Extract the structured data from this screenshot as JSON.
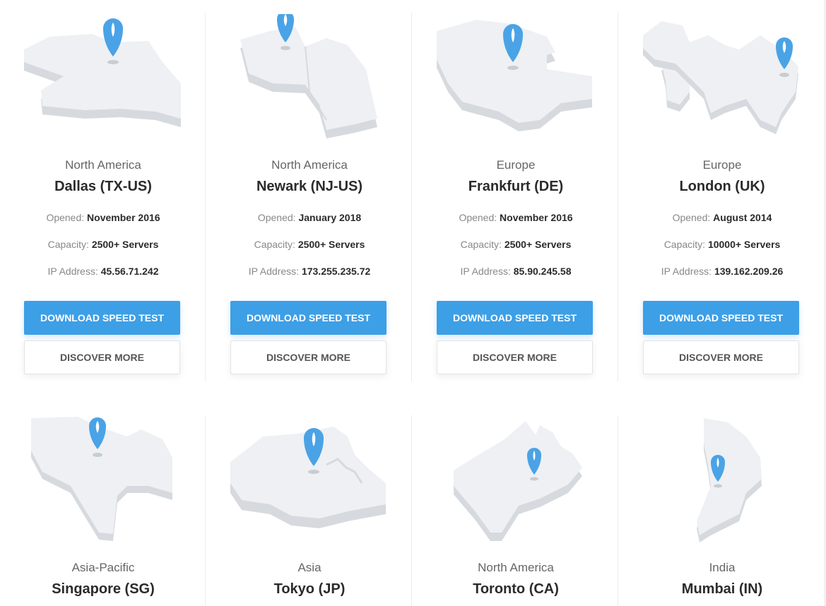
{
  "labels": {
    "opened": "Opened:",
    "capacity": "Capacity:",
    "ip": "IP Address:",
    "download": "DOWNLOAD SPEED TEST",
    "discover": "DISCOVER MORE"
  },
  "colors": {
    "accent": "#3d9fe6",
    "map_top": "#eef0f3",
    "map_side": "#d6dade",
    "pin": "#4aa3e6"
  },
  "locations": [
    {
      "region": "North America",
      "city": "Dallas (TX-US)",
      "opened": "November 2016",
      "capacity": "2500+ Servers",
      "ip": "45.56.71.242"
    },
    {
      "region": "North America",
      "city": "Newark (NJ-US)",
      "opened": "January 2018",
      "capacity": "2500+ Servers",
      "ip": "173.255.235.72"
    },
    {
      "region": "Europe",
      "city": "Frankfurt (DE)",
      "opened": "November 2016",
      "capacity": "2500+ Servers",
      "ip": "85.90.245.58"
    },
    {
      "region": "Europe",
      "city": "London (UK)",
      "opened": "August 2014",
      "capacity": "10000+ Servers",
      "ip": "139.162.209.26"
    },
    {
      "region": "Asia-Pacific",
      "city": "Singapore (SG)"
    },
    {
      "region": "Asia",
      "city": "Tokyo (JP)"
    },
    {
      "region": "North America",
      "city": "Toronto (CA)"
    },
    {
      "region": "India",
      "city": "Mumbai (IN)"
    }
  ]
}
